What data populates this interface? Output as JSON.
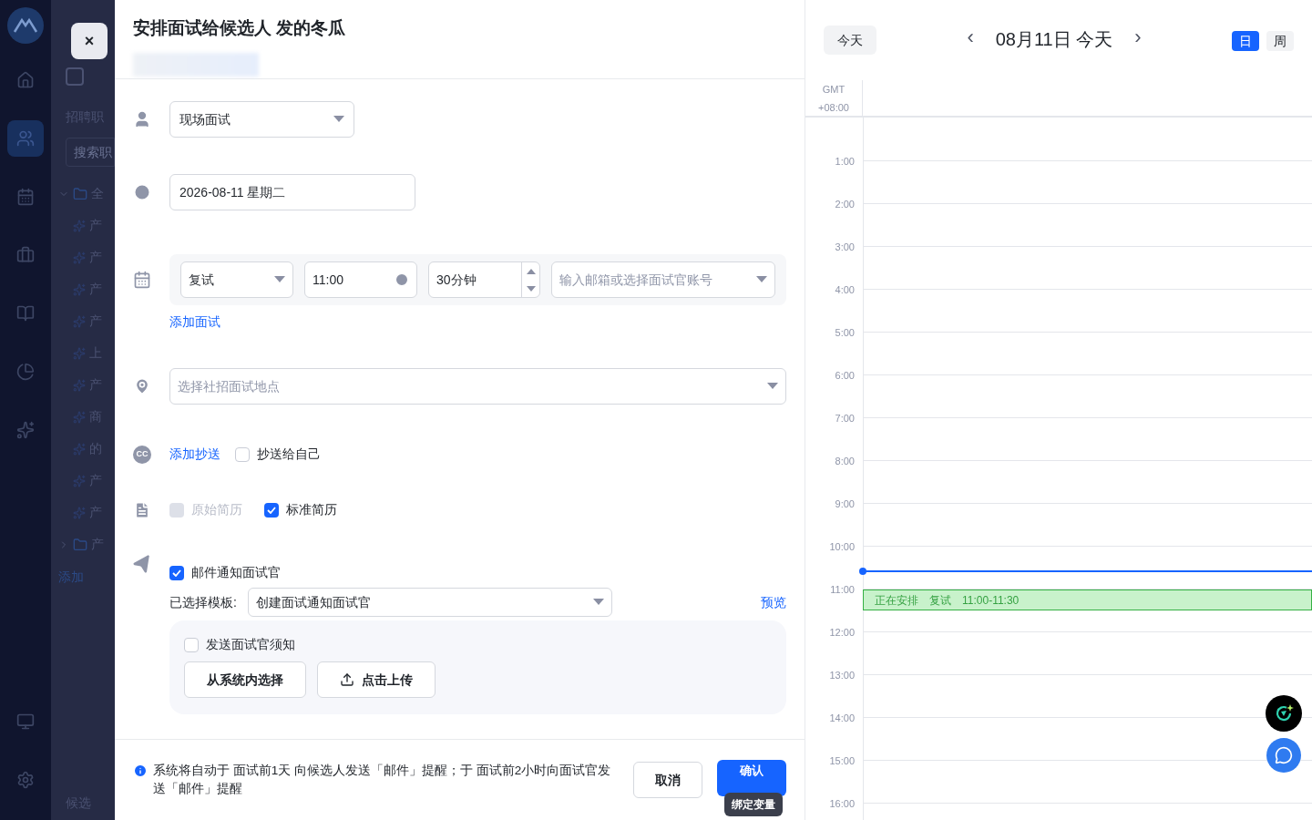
{
  "app_nav": [
    {
      "kind": "logo",
      "selected": false
    },
    {
      "kind": "home",
      "selected": false
    },
    {
      "kind": "people",
      "selected": true
    },
    {
      "kind": "calendar",
      "selected": false
    },
    {
      "kind": "bag",
      "selected": false
    },
    {
      "kind": "book",
      "selected": false
    },
    {
      "kind": "pie",
      "selected": false
    },
    {
      "kind": "spark",
      "selected": false
    }
  ],
  "app_nav_bottom": [
    {
      "kind": "monitor",
      "selected": false
    },
    {
      "kind": "gear",
      "selected": false
    }
  ],
  "background_panel": {
    "section": "招聘职",
    "search_placeholder": "搜索职",
    "tree": [
      {
        "label": "全",
        "expanded": true,
        "children": [
          {
            "label": "产"
          },
          {
            "label": "产"
          },
          {
            "label": "产"
          },
          {
            "label": "产"
          },
          {
            "label": "上"
          },
          {
            "label": "产"
          },
          {
            "label": "商"
          },
          {
            "label": "的"
          },
          {
            "label": "产"
          },
          {
            "label": "产"
          }
        ]
      },
      {
        "label": "产",
        "expanded": false
      }
    ],
    "add_link": "添加",
    "footer": "候选"
  },
  "modal": {
    "close": "×",
    "title": "安排面试给候选人 发的冬瓜",
    "interview_type": "现场面试",
    "date": "2026-08-11 星期二",
    "rounds": [
      {
        "round": "复试",
        "time": "11:00",
        "duration": "30分钟",
        "interviewer_placeholder": "输入邮箱或选择面试官账号"
      }
    ],
    "add_round": "添加面试",
    "location_placeholder": "选择社招面试地点",
    "cc": {
      "icon_text": "CC",
      "link": "添加抄送",
      "self_label": "抄送给自己",
      "self_checked": false
    },
    "resumes": [
      {
        "label": "原始简历",
        "checked": false,
        "disabled": true
      },
      {
        "label": "标准简历",
        "checked": true,
        "disabled": false
      }
    ],
    "mail": {
      "label": "邮件通知面试官",
      "checked": true,
      "template_label": "已选择模板:",
      "template": "创建面试通知面试官",
      "preview": "预览",
      "notice": {
        "label": "发送面试官须知",
        "checked": false,
        "buttons": [
          {
            "label": "从系统内选择",
            "kind": "plain"
          },
          {
            "label": "点击上传",
            "kind": "upload"
          }
        ]
      }
    },
    "footer": {
      "info": "系统将自动于 面试前1天 向候选人发送「邮件」提醒；于 面试前2小时向面试官发送「邮件」提醒",
      "cancel": "取消",
      "confirm": "确认",
      "tooltip": "绑定变量"
    }
  },
  "calendar": {
    "today": "今天",
    "prev": "‹",
    "next": "›",
    "date": "08月11日 今天",
    "views": [
      {
        "label": "日",
        "selected": true
      },
      {
        "label": "周",
        "selected": false
      }
    ],
    "tz": [
      "GMT",
      "+08:00"
    ],
    "hours": [
      {
        "label": "1:00"
      },
      {
        "label": "2:00"
      },
      {
        "label": "3:00"
      },
      {
        "label": "4:00"
      },
      {
        "label": "5:00"
      },
      {
        "label": "6:00"
      },
      {
        "label": "7:00"
      },
      {
        "label": "8:00"
      },
      {
        "label": "9:00"
      },
      {
        "label": "10:00",
        "now": true
      },
      {
        "label": "11:00",
        "event": {
          "status": "正在安排",
          "round": "复试",
          "time": "11:00-11:30"
        }
      },
      {
        "label": "12:00"
      },
      {
        "label": "13:00"
      },
      {
        "label": "14:00"
      },
      {
        "label": "15:00"
      },
      {
        "label": "16:00"
      }
    ]
  }
}
